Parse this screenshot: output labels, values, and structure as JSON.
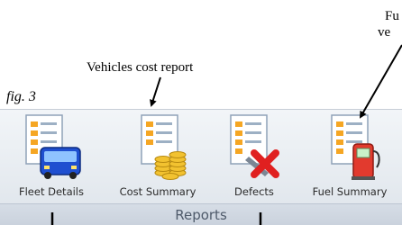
{
  "figure_label": "fig. 3",
  "annotations": {
    "fuel_line1": "Fu",
    "fuel_line2": "ve",
    "cost_report": "Vehicles cost report"
  },
  "ribbon": {
    "group_label": "Reports",
    "buttons": [
      {
        "label": "Fleet Details",
        "icon": "document-bus-icon"
      },
      {
        "label": "Cost Summary",
        "icon": "document-coins-icon"
      },
      {
        "label": "Defects",
        "icon": "document-red-x-icon"
      },
      {
        "label": "Fuel Summary",
        "icon": "document-fuel-pump-icon"
      }
    ]
  },
  "colors": {
    "ribbon_bg": "#e6ebf0",
    "doc_line": "#f5a623",
    "bus": "#1f4fd0",
    "defect_x": "#e02020",
    "pump": "#e23a2e"
  }
}
